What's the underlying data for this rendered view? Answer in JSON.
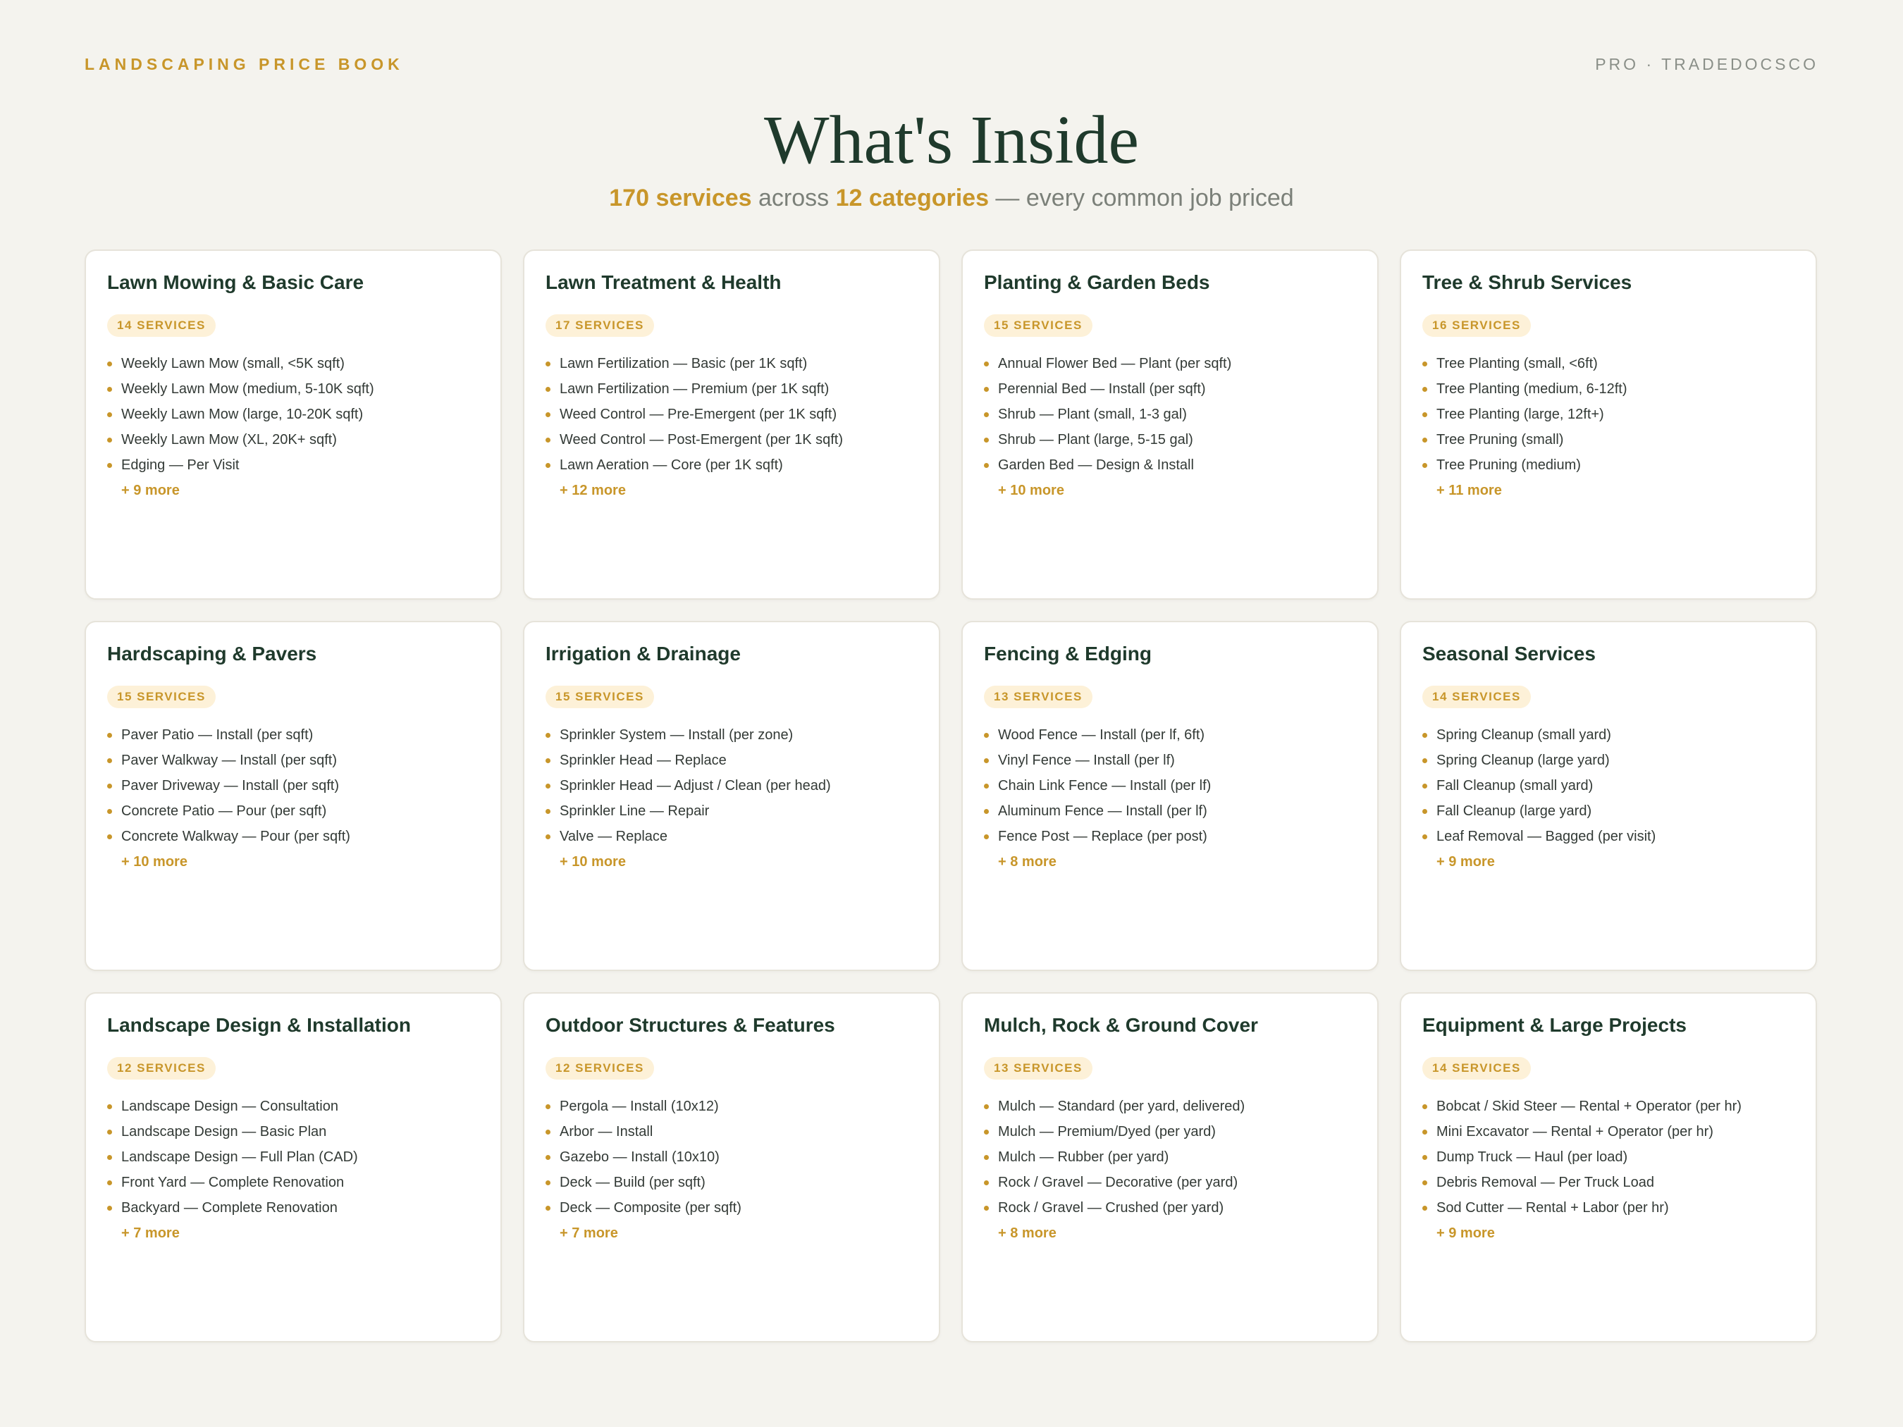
{
  "header": {
    "brand": "LANDSCAPING PRICE BOOK",
    "meta": "PRO · TRADEDOCSCO"
  },
  "title": "What's Inside",
  "subtitle": {
    "services": "170 services",
    "across": " across ",
    "categories": "12 categories",
    "tail": " — every common job priced"
  },
  "cards": [
    {
      "title": "Lawn Mowing & Basic Care",
      "badge": "14 SERVICES",
      "items": [
        "Weekly Lawn Mow (small, <5K sqft)",
        "Weekly Lawn Mow (medium, 5-10K sqft)",
        "Weekly Lawn Mow (large, 10-20K sqft)",
        "Weekly Lawn Mow (XL, 20K+ sqft)",
        "Edging — Per Visit"
      ],
      "more": "+ 9 more"
    },
    {
      "title": "Lawn Treatment & Health",
      "badge": "17 SERVICES",
      "items": [
        "Lawn Fertilization — Basic (per 1K sqft)",
        "Lawn Fertilization — Premium (per 1K sqft)",
        "Weed Control — Pre-Emergent (per 1K sqft)",
        "Weed Control — Post-Emergent (per 1K sqft)",
        "Lawn Aeration — Core (per 1K sqft)"
      ],
      "more": "+ 12 more"
    },
    {
      "title": "Planting & Garden Beds",
      "badge": "15 SERVICES",
      "items": [
        "Annual Flower Bed — Plant (per sqft)",
        "Perennial Bed — Install (per sqft)",
        "Shrub — Plant (small, 1-3 gal)",
        "Shrub — Plant (large, 5-15 gal)",
        "Garden Bed — Design & Install"
      ],
      "more": "+ 10 more"
    },
    {
      "title": "Tree & Shrub Services",
      "badge": "16 SERVICES",
      "items": [
        "Tree Planting (small, <6ft)",
        "Tree Planting (medium, 6-12ft)",
        "Tree Planting (large, 12ft+)",
        "Tree Pruning (small)",
        "Tree Pruning (medium)"
      ],
      "more": "+ 11 more"
    },
    {
      "title": "Hardscaping & Pavers",
      "badge": "15 SERVICES",
      "items": [
        "Paver Patio — Install (per sqft)",
        "Paver Walkway — Install (per sqft)",
        "Paver Driveway — Install (per sqft)",
        "Concrete Patio — Pour (per sqft)",
        "Concrete Walkway — Pour (per sqft)"
      ],
      "more": "+ 10 more"
    },
    {
      "title": "Irrigation & Drainage",
      "badge": "15 SERVICES",
      "items": [
        "Sprinkler System — Install (per zone)",
        "Sprinkler Head — Replace",
        "Sprinkler Head — Adjust / Clean (per head)",
        "Sprinkler Line — Repair",
        "Valve — Replace"
      ],
      "more": "+ 10 more"
    },
    {
      "title": "Fencing & Edging",
      "badge": "13 SERVICES",
      "items": [
        "Wood Fence — Install (per lf, 6ft)",
        "Vinyl Fence — Install (per lf)",
        "Chain Link Fence — Install (per lf)",
        "Aluminum Fence — Install (per lf)",
        "Fence Post — Replace (per post)"
      ],
      "more": "+ 8 more"
    },
    {
      "title": "Seasonal Services",
      "badge": "14 SERVICES",
      "items": [
        "Spring Cleanup (small yard)",
        "Spring Cleanup (large yard)",
        "Fall Cleanup (small yard)",
        "Fall Cleanup (large yard)",
        "Leaf Removal — Bagged (per visit)"
      ],
      "more": "+ 9 more"
    },
    {
      "title": "Landscape Design & Installation",
      "badge": "12 SERVICES",
      "items": [
        "Landscape Design — Consultation",
        "Landscape Design — Basic Plan",
        "Landscape Design — Full Plan (CAD)",
        "Front Yard — Complete Renovation",
        "Backyard — Complete Renovation"
      ],
      "more": "+ 7 more"
    },
    {
      "title": "Outdoor Structures & Features",
      "badge": "12 SERVICES",
      "items": [
        "Pergola — Install (10x12)",
        "Arbor — Install",
        "Gazebo — Install (10x10)",
        "Deck — Build (per sqft)",
        "Deck — Composite (per sqft)"
      ],
      "more": "+ 7 more"
    },
    {
      "title": "Mulch, Rock & Ground Cover",
      "badge": "13 SERVICES",
      "items": [
        "Mulch — Standard (per yard, delivered)",
        "Mulch — Premium/Dyed (per yard)",
        "Mulch — Rubber (per yard)",
        "Rock / Gravel — Decorative (per yard)",
        "Rock / Gravel — Crushed (per yard)"
      ],
      "more": "+ 8 more"
    },
    {
      "title": "Equipment & Large Projects",
      "badge": "14 SERVICES",
      "items": [
        "Bobcat / Skid Steer — Rental + Operator (per hr)",
        "Mini Excavator — Rental + Operator (per hr)",
        "Dump Truck — Haul (per load)",
        "Debris Removal — Per Truck Load",
        "Sod Cutter — Rental + Labor (per hr)"
      ],
      "more": "+ 9 more"
    }
  ]
}
